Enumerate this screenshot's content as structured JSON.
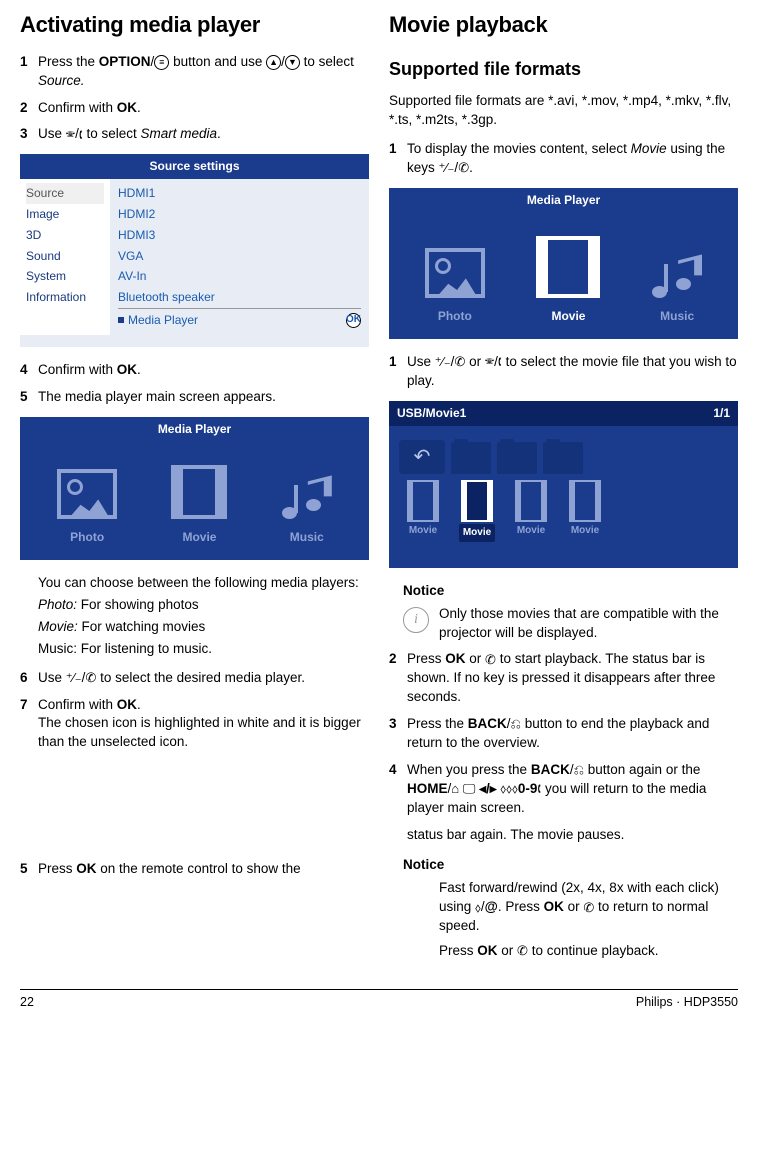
{
  "left": {
    "h1": "Activating media player",
    "steps": [
      {
        "n": "1",
        "text": "Press the <strong>OPTION</strong>/<span class='glyph'>≡</span> button and use <span class='glyph'>▲</span>/<span class='glyph'>▼</span> to select <em>Source.</em>"
      },
      {
        "n": "2",
        "text": "Confirm with <strong>OK</strong>."
      },
      {
        "n": "3",
        "text": "Use <span class='glyph plain'>🕾</span>/<span class='glyph plain'>🕻</span> to select <em>Smart media</em>."
      }
    ],
    "source_title": "Source settings",
    "source_left": [
      "Source",
      "Image",
      "3D",
      "Sound",
      "System",
      "Information"
    ],
    "source_right": [
      "HDMI1",
      "HDMI2",
      "HDMI3",
      "VGA",
      "AV-In",
      "Bluetooth speaker"
    ],
    "source_marked": "Media Player",
    "ok_mark": "OK",
    "steps2": [
      {
        "n": "4",
        "text": "Confirm with <strong>OK</strong>."
      },
      {
        "n": "5",
        "text": "The media player main screen appears."
      }
    ],
    "mp_title": "Media Player",
    "mp_items": [
      {
        "label": "Photo"
      },
      {
        "label": "Movie"
      },
      {
        "label": "Music"
      }
    ],
    "desc": [
      "You can choose between the following media players:",
      "<em>Photo:</em> For showing photos",
      "<em>Movie:</em> For watching movies",
      "Music: For listening to music."
    ],
    "steps3": [
      {
        "n": "6",
        "text": "Use <span class='glyph plain'>⁺⁄₋</span>/<span class='glyph plain'>✆</span> to select the desired media player."
      },
      {
        "n": "7",
        "text": "Confirm with <strong>OK</strong>.<br>The chosen icon is highlighted in white and it is bigger than the unselected icon."
      }
    ],
    "steps4": [
      {
        "n": "5",
        "text": "Press <strong>OK</strong> on the remote control to show the"
      }
    ]
  },
  "right": {
    "h1": "Movie playback",
    "h2": "Supported file formats",
    "intro": "Supported file formats are *.avi, *.mov, *.mp4, *.mkv, *.flv, *.ts, *.m2ts, *.3gp.",
    "steps": [
      {
        "n": "1",
        "text": "To display the movies content, select <em>Movie</em> using the keys <span class='glyph plain'>⁺⁄₋</span>/<span class='glyph plain'>✆</span>."
      }
    ],
    "mp_title": "Media Player",
    "steps2": [
      {
        "n": "1",
        "text": "Use <span class='glyph plain'>⁺⁄₋</span>/<span class='glyph plain'>✆</span> or <span class='glyph plain'>🕾</span>/<span class='glyph plain'>🕻</span> to select the movie file that you wish to play."
      }
    ],
    "browser_title_left": "USB/Movie1",
    "browser_title_right": "1/1",
    "file_label": "Movie",
    "notice1": {
      "title": "Notice",
      "text": "Only those movies that are compatible with the projector will be displayed."
    },
    "steps3": [
      {
        "n": "2",
        "text": "Press <strong>OK</strong> or <span class='glyph plain'>✆</span> to start playback. The status bar is shown. If no key is pressed it disappears after three seconds."
      },
      {
        "n": "3",
        "text": "Press the <strong>BACK</strong>/<span class='glyph plain'>⎌</span> button to end the playback and return to the overview."
      },
      {
        "n": "4",
        "text": "When you press the <strong>BACK</strong>/<span class='glyph plain'>⎌</span> button again or the <strong>HOME</strong>/<span class='glyph plain'>⌂</span> <span class='glyph plain'>🖵</span> <strong>◂/▸</strong> <span class='glyph plain'>⬨⬨⬨</span><strong>0-9</strong><span class='glyph plain'>🕻</span> you will return to the media player main screen."
      }
    ],
    "continuation": "status bar again. The movie pauses.",
    "notice2": {
      "title": "Notice",
      "text1": "Fast forward/rewind (2x, 4x, 8x with each click) using <span class='glyph plain'>⬨</span>/<strong>@</strong>. Press <strong>OK</strong> or <span class='glyph plain'>✆</span> to return to normal speed.",
      "text2": "Press <strong>OK</strong> or <span class='glyph plain'>✆</span> to continue playback."
    }
  },
  "footer": {
    "left": "22",
    "right": "Philips · HDP3550"
  }
}
